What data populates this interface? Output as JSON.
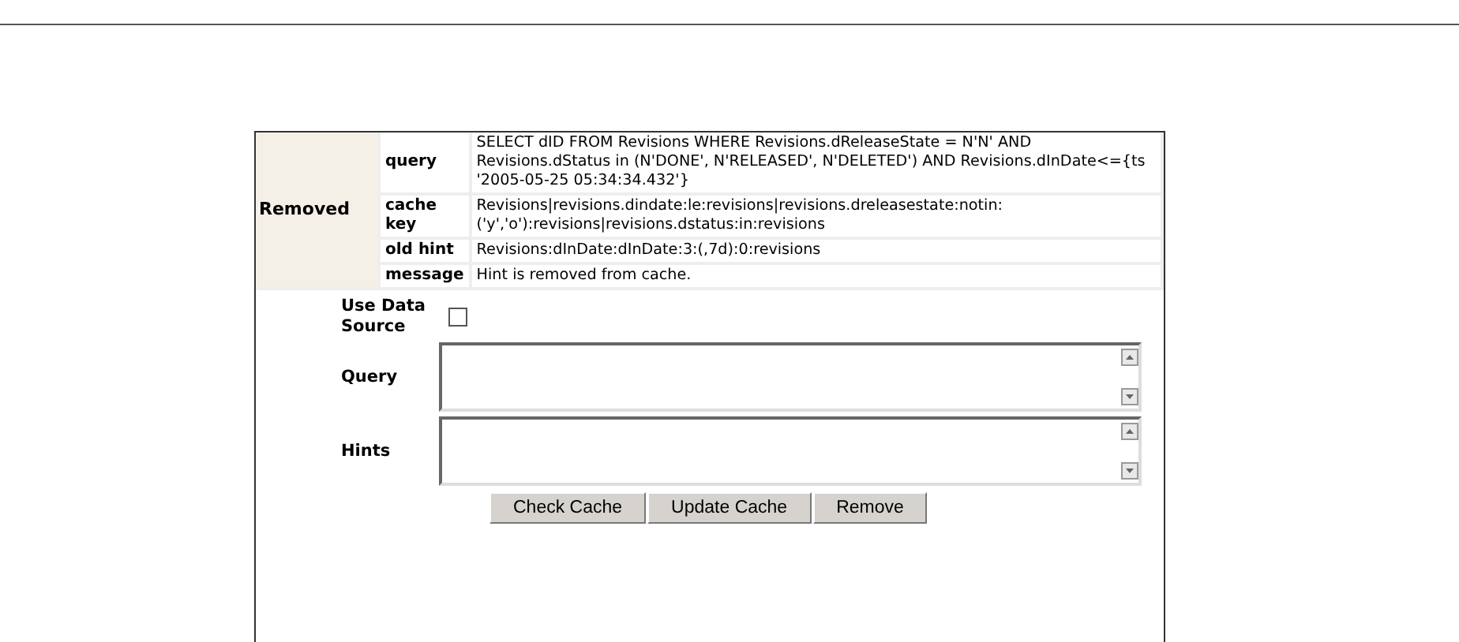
{
  "result": {
    "group": "Removed",
    "rows": [
      {
        "label": "query",
        "value": "SELECT dID FROM Revisions WHERE Revisions.dReleaseState = N'N' AND Revisions.dStatus in (N'DONE', N'RELEASED', N'DELETED') AND Revisions.dInDate<={ts '2005-05-25 05:34:34.432'}"
      },
      {
        "label": "cache key",
        "value": "Revisions|revisions.dindate:le:revisions|revisions.dreleasestate:notin:('y','o'):revisions|revisions.dstatus:in:revisions"
      },
      {
        "label": "old hint",
        "value": "Revisions:dInDate:dInDate:3:(,7d):0:revisions"
      },
      {
        "label": "message",
        "value": "Hint is removed from cache."
      }
    ]
  },
  "form": {
    "use_data_source": {
      "label": "Use Data Source",
      "checked": false
    },
    "fields": [
      {
        "label": "Query"
      },
      {
        "label": "Hints"
      }
    ],
    "buttons": [
      "Check Cache",
      "Update Cache",
      "Remove"
    ]
  }
}
